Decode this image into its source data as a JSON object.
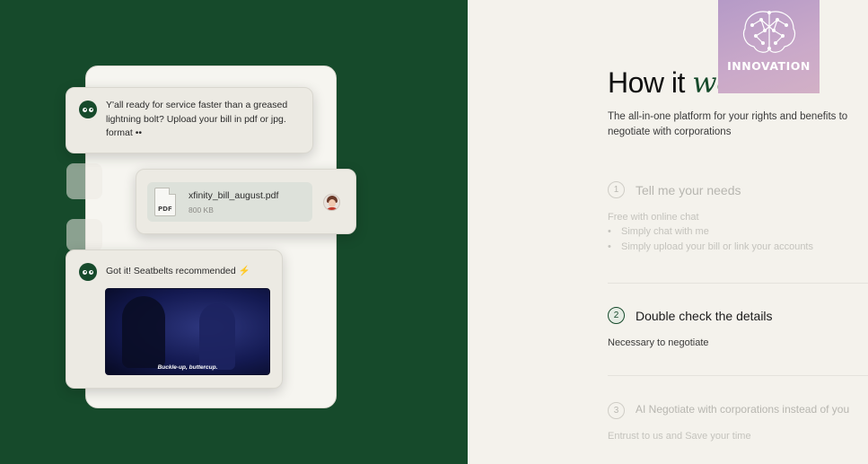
{
  "chat": {
    "bot_message_1": "Y'all ready for service faster than a greased lightning bolt? Upload your bill in pdf or jpg. format",
    "bot_message_1_emoji": "••",
    "file": {
      "name": "xfinity_bill_august.pdf",
      "size": "800 KB",
      "icon_label": "PDF"
    },
    "bot_message_2": "Got it! Seatbelts recommended",
    "bot_message_2_emoji": "⚡",
    "video_caption": "Buckle-up, buttercup."
  },
  "heading": {
    "title_plain": "How it",
    "title_script": "works",
    "subtitle": "The all-in-one platform for your rights and benefits to negotiate with corporations"
  },
  "steps": [
    {
      "number": "1",
      "title": "Tell me your needs",
      "description": "Free with online chat",
      "bullets": [
        "Simply chat with me",
        "Simply upload your bill or link your accounts"
      ]
    },
    {
      "number": "2",
      "title": "Double check the details",
      "description": "Necessary to negotiate"
    },
    {
      "number": "3",
      "title": "AI Negotiate with corporations instead of you",
      "description": "Entrust to us and Save your time"
    }
  ],
  "badge": {
    "label": "INNOVATION"
  },
  "colors": {
    "brand_green": "#164a2b",
    "background": "#f4f2ec",
    "badge": "#caa9c9"
  }
}
